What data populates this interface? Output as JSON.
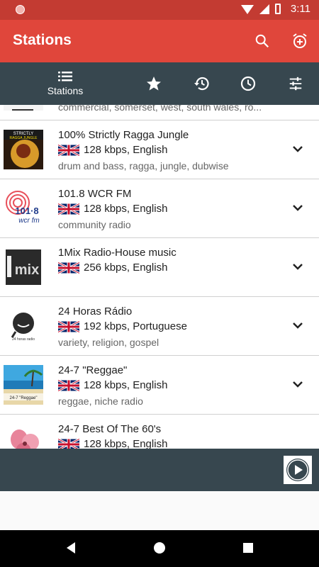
{
  "status_bar": {
    "time": "3:11"
  },
  "app_bar": {
    "title": "Stations",
    "actions": [
      "search-icon",
      "alarm-add-icon"
    ]
  },
  "tabs": [
    {
      "label": "Stations",
      "icon": "list-icon",
      "active": true
    },
    {
      "icon": "star-icon"
    },
    {
      "icon": "history-icon"
    },
    {
      "icon": "clock-icon"
    },
    {
      "icon": "tune-icon"
    }
  ],
  "stations": [
    {
      "name": "",
      "meta": "",
      "tags": "commercial, somerset, west, south wales, ro..."
    },
    {
      "name": "100% Strictly Ragga Jungle",
      "meta": "128 kbps, English",
      "tags": "drum and bass, ragga, jungle, dubwise",
      "logo_text": "STRICTLY RAGGA JUNGLE"
    },
    {
      "name": "101.8 WCR FM",
      "meta": "128 kbps, English",
      "tags": "community radio",
      "logo_text": "101·8 wcr fm"
    },
    {
      "name": "1Mix Radio-House music",
      "meta": "256 kbps, English",
      "tags": "",
      "logo_text": "1mix"
    },
    {
      "name": "24 Horas Rádio",
      "meta": "192 kbps, Portuguese",
      "tags": "variety, religion, gospel",
      "logo_text": "24 horas radio"
    },
    {
      "name": "24-7 \"Reggae\"",
      "meta": "128 kbps, English",
      "tags": "reggae, niche radio",
      "logo_text": "24-7 \"Reggae\""
    },
    {
      "name": "24-7 Best Of The 60's",
      "meta": "128 kbps, English",
      "tags": ""
    }
  ],
  "colors": {
    "status_bar": "#c33b32",
    "app_bar": "#e0463b",
    "tab_bar": "#37474f"
  }
}
